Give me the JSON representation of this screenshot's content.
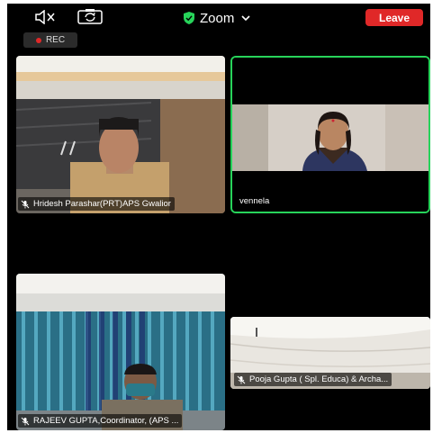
{
  "topbar": {
    "title": "Zoom",
    "leave_label": "Leave",
    "icons": [
      "speaker-icon",
      "camera-flip-icon",
      "shield-icon",
      "chevron-down-icon"
    ],
    "colors": {
      "leave": "#e02828",
      "shield": "#27d35a",
      "active_border": "#27d35a"
    }
  },
  "recording": {
    "label": "REC"
  },
  "participants": [
    {
      "name": "Hridesh Parashar(PRT)APS Gwalior",
      "muted": true
    },
    {
      "name": "vennela",
      "muted": false,
      "active_speaker": true
    },
    {
      "name": "RAJEEV GUPTA,Coordinator, (APS ...",
      "muted": true
    },
    {
      "name": "Pooja Gupta ( Spl. Educa) & Archa...",
      "muted": true
    }
  ]
}
